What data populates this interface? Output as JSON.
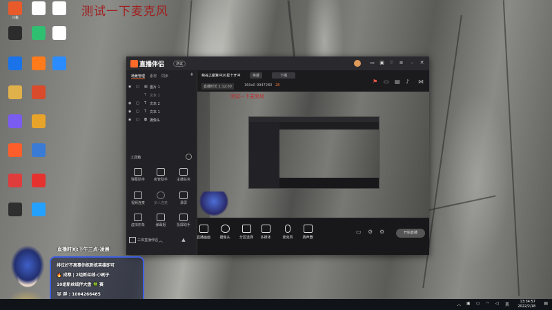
{
  "desktop": {
    "overlay_title": "测试一下麦克风",
    "icons": [
      {
        "label": "斗鱼",
        "color": "#e85a2a"
      },
      {
        "label": "",
        "color": "#ffffff"
      },
      {
        "label": "",
        "color": "#ffffff"
      },
      {
        "label": "",
        "color": "#2c2c2c"
      },
      {
        "label": "",
        "color": "#2fbf71"
      },
      {
        "label": "",
        "color": "#ffffff"
      },
      {
        "label": "",
        "color": "#1a73e8"
      },
      {
        "label": "",
        "color": "#ff7a1a"
      },
      {
        "label": "",
        "color": "#2a8cff"
      },
      {
        "label": "",
        "color": "#e0b04a"
      },
      {
        "label": "",
        "color": "#d94b2b"
      },
      {
        "label": "",
        "color": "#7a5cf0"
      },
      {
        "label": "",
        "color": "#e8a42a"
      },
      {
        "label": "",
        "color": "#ff5e2a"
      },
      {
        "label": "",
        "color": "#3a7bd5"
      },
      {
        "label": "",
        "color": "#e03c3c"
      },
      {
        "label": "",
        "color": "#e6322e"
      },
      {
        "label": "",
        "color": "#2f2f2f"
      },
      {
        "label": "",
        "color": "#24a0ff"
      },
      {
        "label": "",
        "color": "#4caf50"
      },
      {
        "label": "",
        "color": "#f2b01e"
      },
      {
        "label": "",
        "color": "#2ea0e0"
      },
      {
        "label": "",
        "color": "#f0a020"
      },
      {
        "label": "",
        "color": "#ffffff"
      }
    ]
  },
  "app": {
    "brand": "直播伴侣",
    "beta": "测试",
    "left_tabs": [
      "场景管理",
      "素材",
      "同步"
    ],
    "scenes": [
      "图片 1",
      "文本 1",
      "文本 2",
      "文本 1",
      "摄像头"
    ],
    "tools_header": "工具箱",
    "tools": [
      {
        "label": "弹幕助手"
      },
      {
        "label": "房管助手"
      },
      {
        "label": "主播任务"
      },
      {
        "label": "视频连麦"
      },
      {
        "label": "多人连麦"
      },
      {
        "label": "录屏"
      },
      {
        "label": "虚拟形象"
      },
      {
        "label": "弹幕姬"
      },
      {
        "label": "投屏助手"
      },
      {
        "label": "三体直播伴侣"
      },
      {
        "label": ""
      },
      {
        "label": ""
      }
    ],
    "status_title": "峡谷之巅算冲20星十开冲",
    "status_tag": "英雄",
    "status_btn": "下播",
    "stream_meta": [
      "直播时长 1:12:00",
      "160x0",
      "9947280",
      "28"
    ],
    "preview_text": "测试一下麦克风",
    "bottom_buttons": [
      {
        "label": "直播画面"
      },
      {
        "label": "摄像头"
      },
      {
        "label": "分区选择"
      },
      {
        "label": "多媒体"
      },
      {
        "label": "麦克风"
      },
      {
        "label": "扬声器"
      }
    ],
    "start_label": "开始直播"
  },
  "overlay": {
    "schedule": "直播时间:下午三点-凌晨",
    "lines": [
      "排位好不高事你练新练英雄即可",
      "🔥 成都 | 2组新丝绒-小刷子",
      "10组新丝绒伴大盘 🍀 赛",
      "🐺 群 : 1004266485"
    ]
  },
  "taskbar": {
    "time": "13:34:57",
    "date": "2022/2/18"
  }
}
